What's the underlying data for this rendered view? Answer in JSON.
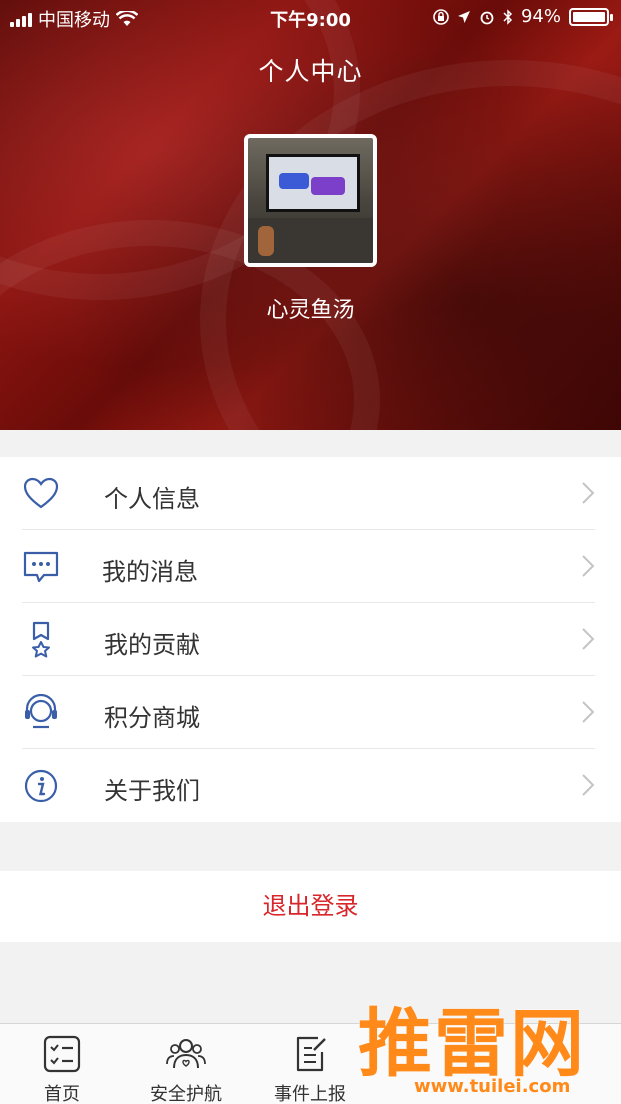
{
  "status": {
    "carrier": "中国移动",
    "time": "下午9:00",
    "battery": "94%",
    "battery_level": 0.94
  },
  "header": {
    "title": "个人中心",
    "username": "心灵鱼汤"
  },
  "menu": {
    "items": [
      {
        "label": "个人信息",
        "icon": "heart-icon"
      },
      {
        "label": "我的消息",
        "icon": "message-icon"
      },
      {
        "label": "我的贡献",
        "icon": "medal-icon"
      },
      {
        "label": "积分商城",
        "icon": "headset-icon"
      },
      {
        "label": "关于我们",
        "icon": "info-icon"
      }
    ]
  },
  "logout_label": "退出登录",
  "tabbar": {
    "tabs": [
      {
        "label": "首页",
        "icon": "checklist-icon"
      },
      {
        "label": "安全护航",
        "icon": "people-icon"
      },
      {
        "label": "事件上报",
        "icon": "edit-icon"
      }
    ]
  },
  "watermark": {
    "text": "推雷网",
    "url": "www.tuilei.com"
  },
  "colors": {
    "accent_icon": "#3a5fa8",
    "logout_red": "#d8262b",
    "hero_red": "#8a1410",
    "watermark_orange": "#ff8a1a"
  }
}
